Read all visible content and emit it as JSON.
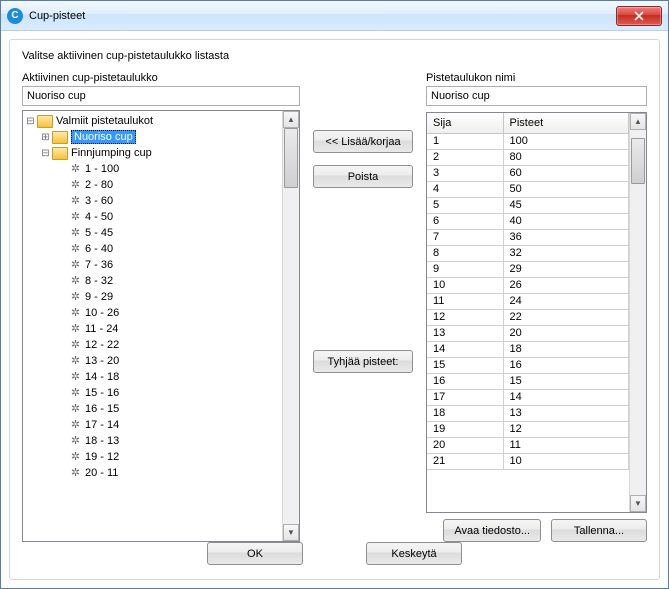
{
  "window": {
    "title": "Cup-pisteet"
  },
  "instruction": "Valitse aktiivinen cup-pistetaulukko listasta",
  "left": {
    "label": "Aktiivinen cup-pistetaulukko",
    "value": "Nuoriso cup",
    "tree": {
      "root": "Valmiit pistetaulukot",
      "item_selected": "Nuoriso cup",
      "item_expanded": "Finnjumping cup",
      "leaves": [
        "1 - 100",
        "2 - 80",
        "3 - 60",
        "4 - 50",
        "5 - 45",
        "6 - 40",
        "7 - 36",
        "8 - 32",
        "9 - 29",
        "10 - 26",
        "11 - 24",
        "12 - 22",
        "13 - 20",
        "14 - 18",
        "15 - 16",
        "16 - 15",
        "17 - 14",
        "18 - 13",
        "19 - 12",
        "20 - 11"
      ]
    }
  },
  "mid": {
    "add": "<< Lisää/korjaa",
    "remove": "Poista",
    "clear": "Tyhjää pisteet:"
  },
  "right": {
    "name_label": "Pistetaulukon nimi",
    "name_value": "Nuoriso cup",
    "col_sija": "Sija",
    "col_pisteet": "Pisteet",
    "rows": [
      {
        "s": "1",
        "p": "100"
      },
      {
        "s": "2",
        "p": "80"
      },
      {
        "s": "3",
        "p": "60"
      },
      {
        "s": "4",
        "p": "50"
      },
      {
        "s": "5",
        "p": "45"
      },
      {
        "s": "6",
        "p": "40"
      },
      {
        "s": "7",
        "p": "36"
      },
      {
        "s": "8",
        "p": "32"
      },
      {
        "s": "9",
        "p": "29"
      },
      {
        "s": "10",
        "p": "26"
      },
      {
        "s": "11",
        "p": "24"
      },
      {
        "s": "12",
        "p": "22"
      },
      {
        "s": "13",
        "p": "20"
      },
      {
        "s": "14",
        "p": "18"
      },
      {
        "s": "15",
        "p": "16"
      },
      {
        "s": "16",
        "p": "15"
      },
      {
        "s": "17",
        "p": "14"
      },
      {
        "s": "18",
        "p": "13"
      },
      {
        "s": "19",
        "p": "12"
      },
      {
        "s": "20",
        "p": "11"
      },
      {
        "s": "21",
        "p": "10"
      }
    ],
    "open": "Avaa tiedosto...",
    "save": "Tallenna..."
  },
  "buttons": {
    "ok": "OK",
    "cancel": "Keskeytä"
  }
}
